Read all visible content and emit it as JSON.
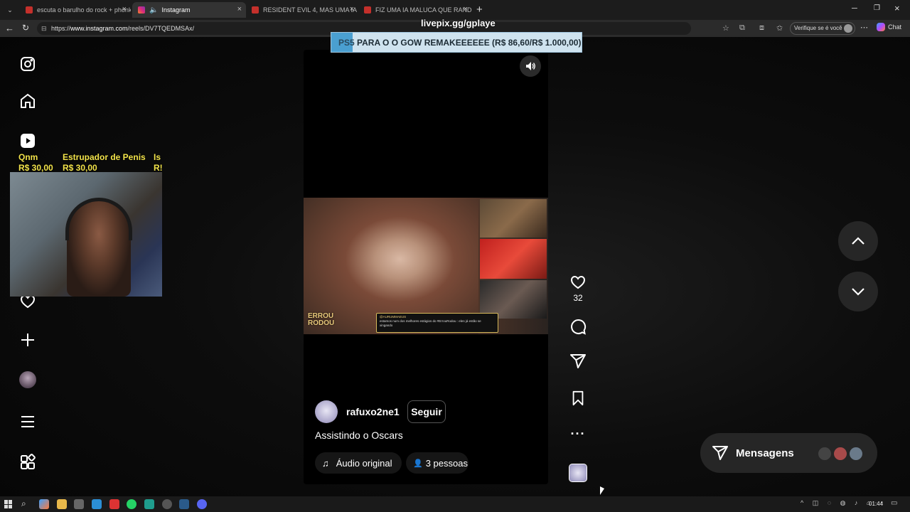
{
  "browser": {
    "tabs": [
      {
        "label": "escuta o barulho do rock + phonk",
        "active": false
      },
      {
        "label": "Instagram",
        "active": true
      },
      {
        "label": "RESIDENT EVIL 4, MAS UMA IA MU",
        "active": false
      },
      {
        "label": "FIZ UMA IA MALUCA QUE RANDO",
        "active": false
      }
    ],
    "url_prefix": "https://",
    "url_host": "www.instagram.com",
    "url_path": "/reels/DV7TQEDMSAx/",
    "profile_label": "Verifique se é você",
    "chat_label": "Chat"
  },
  "overlay": {
    "livepix": "livepix.gg/gplaye",
    "goal_tag": "PS5",
    "goal_text": "PARA O O GOW REMAKEEEEEE (R$ 86,60/R$ 1.000,00)",
    "goal_progress": 0.0866,
    "donors": [
      {
        "name": "Qnm",
        "amount": "R$ 30,00"
      },
      {
        "name": "Estrupador de Penis",
        "amount": "R$ 30,00"
      },
      {
        "name": "Is",
        "amount": "R!"
      }
    ]
  },
  "reel": {
    "username": "rafuxo2ne1",
    "follow_label": "Seguir",
    "caption": "Assistindo o Oscars",
    "audio_label": "Áudio original",
    "people_label": "3 pessoas",
    "likes": "32",
    "video_brand": "ERROU RODOU",
    "video_comment_user": "@AURUMMAEUS",
    "video_comment_text": "estamos num dos melhores estágios do #ErrouRodou : eles já estão se xingando"
  },
  "messages": {
    "label": "Mensagens"
  },
  "taskbar": {
    "time": "01:44"
  },
  "colors": {
    "goal_bg": "#cfe3ef",
    "goal_tag_bg": "#4a9fd0",
    "donor_text": "#f2e34a"
  }
}
